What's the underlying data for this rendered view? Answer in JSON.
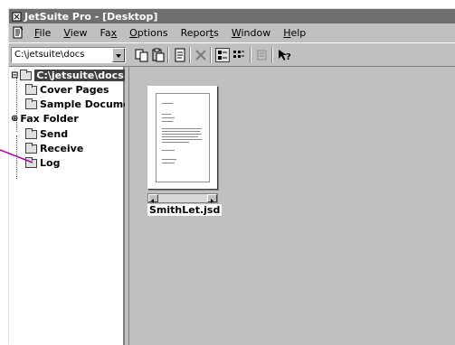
{
  "window": {
    "title": "JetSuite Pro - [Desktop]"
  },
  "menu": {
    "items": [
      {
        "accel": "F",
        "rest": "ile"
      },
      {
        "accel": "V",
        "rest": "iew"
      },
      {
        "pre": "Fa",
        "accel": "x",
        "rest": ""
      },
      {
        "accel": "O",
        "rest": "ptions"
      },
      {
        "pre": "Repor",
        "accel": "t",
        "rest": "s"
      },
      {
        "accel": "W",
        "rest": "indow"
      },
      {
        "accel": "H",
        "rest": "elp"
      }
    ]
  },
  "toolbar": {
    "path_value": "C:\\jetsuite\\docs",
    "buttons": [
      "copy-icon",
      "paste-icon",
      "document-icon",
      "delete-icon",
      "large-icons-icon",
      "list-view-icon",
      "details-icon",
      "help-icon"
    ]
  },
  "tree": {
    "items": [
      {
        "label": "C:\\jetsuite\\docs",
        "selected": true
      },
      {
        "label": "Cover Pages"
      },
      {
        "label": "Sample Documen"
      },
      {
        "label": "Fax Folder"
      },
      {
        "label": "Send"
      },
      {
        "label": "Receive"
      },
      {
        "label": "Log"
      }
    ]
  },
  "files": [
    {
      "name": "SmithLet.jsd"
    }
  ],
  "colors": {
    "titlebar": "#6f6f6f",
    "face": "#c0c0c0",
    "callout": "#b000b0"
  }
}
